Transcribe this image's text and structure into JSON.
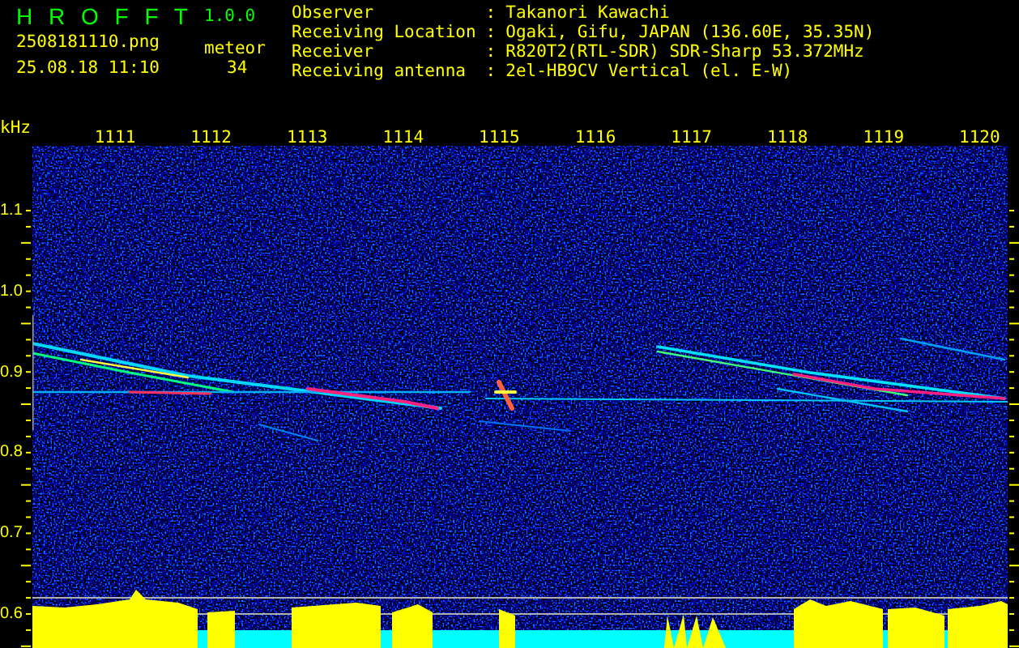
{
  "app": {
    "name": "H R O F F T",
    "version": "1.0.0"
  },
  "file": {
    "name": "2508181110.png",
    "timestamp": "25.08.18 11:10"
  },
  "meteor": {
    "label": "meteor",
    "count": "34"
  },
  "info": [
    {
      "label": "Observer",
      "separator": ":",
      "value": "Takanori Kawachi"
    },
    {
      "label": "Receiving Location",
      "separator": ":",
      "value": "Ogaki, Gifu, JAPAN (136.60E, 35.35N)"
    },
    {
      "label": "Receiver",
      "separator": ":",
      "value": "R820T2(RTL-SDR) SDR-Sharp 53.372MHz"
    },
    {
      "label": "Receiving antenna",
      "separator": ":",
      "value": "2el-HB9CV Vertical (el. E-W)"
    }
  ],
  "axis": {
    "unit": "kHz",
    "x_ticks": [
      "1111",
      "1112",
      "1113",
      "1114",
      "1115",
      "1116",
      "1117",
      "1118",
      "1119",
      "1120"
    ],
    "y_ticks": [
      "1.1",
      "1.0",
      "0.9",
      "0.8",
      "0.7",
      "0.6"
    ]
  }
}
